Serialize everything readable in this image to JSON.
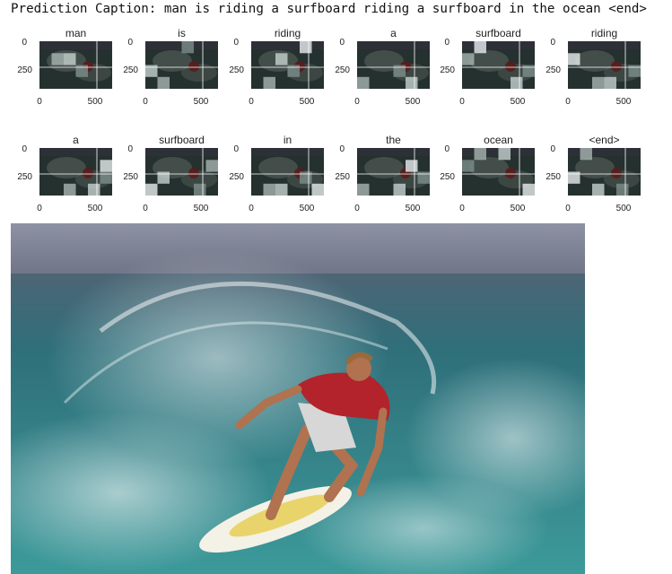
{
  "caption": {
    "prefix": "Prediction Caption:",
    "text": "man is riding a surfboard riding a surfboard in the ocean <end>"
  },
  "axes": {
    "y_tick_0": "0",
    "y_tick_250": "250",
    "x_tick_0": "0",
    "x_tick_500": "500"
  },
  "attention_panels": [
    {
      "word": "man",
      "cells": [
        [
          1,
          1
        ],
        [
          1,
          2
        ],
        [
          2,
          3
        ]
      ]
    },
    {
      "word": "is",
      "cells": [
        [
          3,
          1
        ],
        [
          2,
          0
        ],
        [
          0,
          3
        ]
      ]
    },
    {
      "word": "riding",
      "cells": [
        [
          3,
          1
        ],
        [
          1,
          2
        ],
        [
          2,
          3
        ],
        [
          0,
          4
        ]
      ]
    },
    {
      "word": "a",
      "cells": [
        [
          3,
          0
        ],
        [
          3,
          4
        ],
        [
          2,
          3
        ]
      ]
    },
    {
      "word": "surfboard",
      "cells": [
        [
          1,
          0
        ],
        [
          3,
          4
        ],
        [
          2,
          5
        ],
        [
          0,
          1
        ]
      ]
    },
    {
      "word": "riding",
      "cells": [
        [
          3,
          2
        ],
        [
          3,
          3
        ],
        [
          2,
          5
        ],
        [
          1,
          0
        ]
      ]
    },
    {
      "word": "a",
      "cells": [
        [
          3,
          2
        ],
        [
          3,
          4
        ],
        [
          2,
          5
        ],
        [
          1,
          5
        ]
      ]
    },
    {
      "word": "surfboard",
      "cells": [
        [
          1,
          5
        ],
        [
          2,
          1
        ],
        [
          3,
          4
        ],
        [
          3,
          0
        ]
      ]
    },
    {
      "word": "in",
      "cells": [
        [
          3,
          1
        ],
        [
          3,
          2
        ],
        [
          2,
          4
        ],
        [
          3,
          5
        ]
      ]
    },
    {
      "word": "the",
      "cells": [
        [
          3,
          0
        ],
        [
          3,
          3
        ],
        [
          2,
          5
        ],
        [
          1,
          4
        ]
      ]
    },
    {
      "word": "ocean",
      "cells": [
        [
          0,
          1
        ],
        [
          0,
          3
        ],
        [
          1,
          0
        ],
        [
          3,
          5
        ]
      ]
    },
    {
      "word": "<end>",
      "cells": [
        [
          0,
          1
        ],
        [
          3,
          2
        ],
        [
          3,
          4
        ],
        [
          2,
          0
        ]
      ]
    }
  ],
  "colors": {
    "sky": "#7b8091",
    "sea": "#2f7f86",
    "shirt": "#b3232b",
    "board": "#e9d46c"
  }
}
